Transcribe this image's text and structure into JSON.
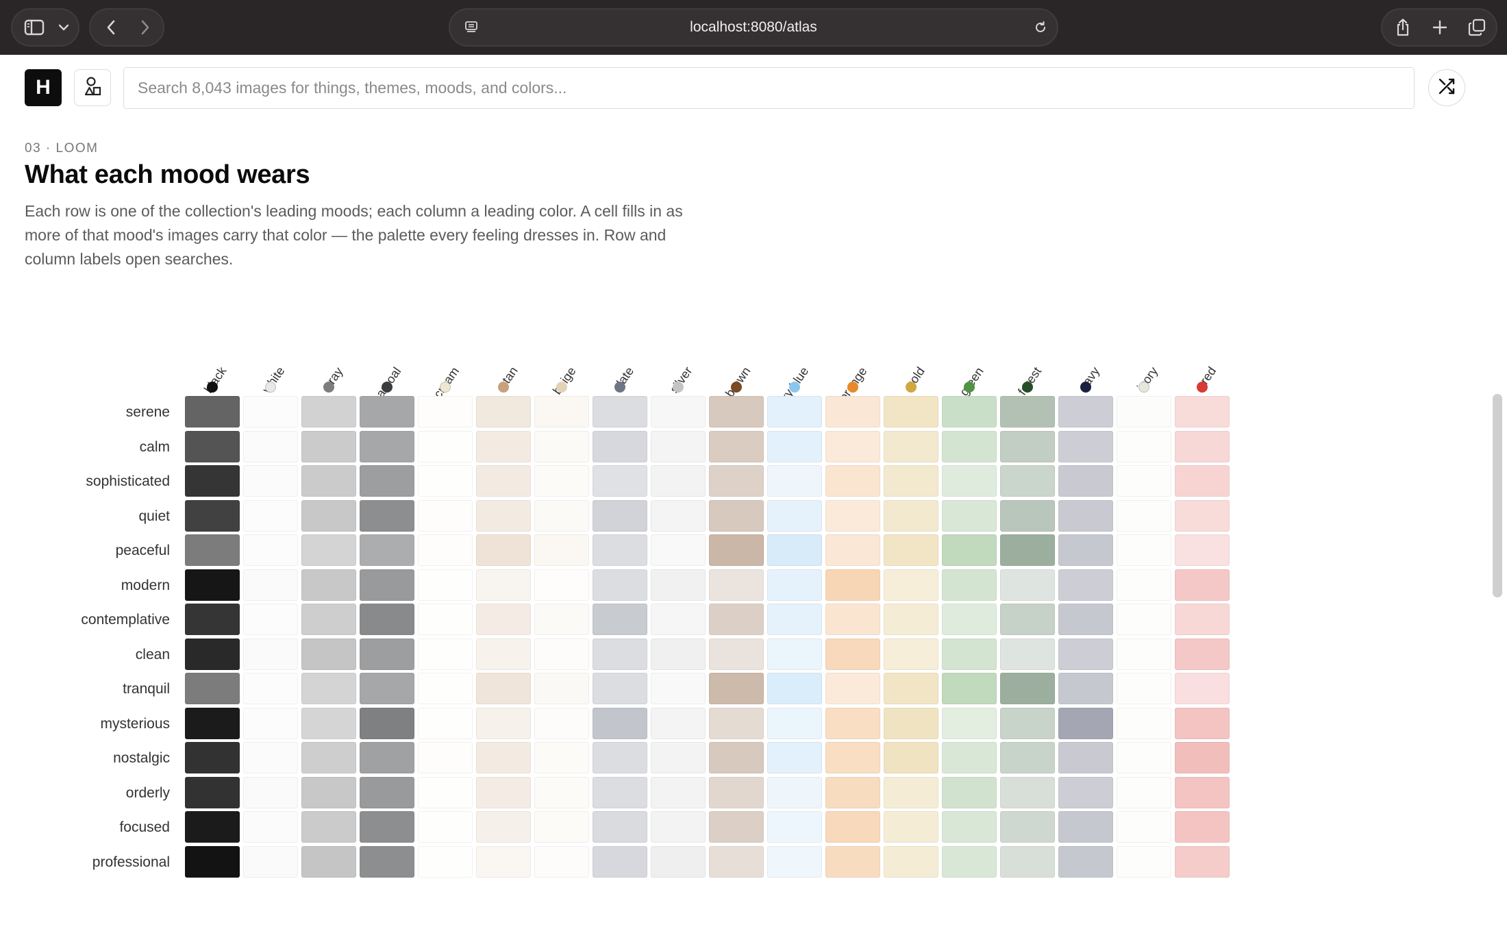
{
  "browser": {
    "url": "localhost:8080/atlas"
  },
  "header": {
    "logo_letter": "H",
    "search_placeholder": "Search 8,043 images for things, themes, moods, and colors..."
  },
  "intro": {
    "eyebrow": "03 · LOOM",
    "title": "What each mood wears",
    "description": "Each row is one of the collection's leading moods; each column a leading color. A cell fills in as more of that mood's images carry that color — the palette every feeling dresses in. Row and column labels open searches."
  },
  "heatmap": {
    "columns": [
      {
        "label": "black",
        "color": "#111111"
      },
      {
        "label": "white",
        "color": "#e8e8e8"
      },
      {
        "label": "gray",
        "color": "#7d7d7d"
      },
      {
        "label": "charcoal",
        "color": "#3a3c3f"
      },
      {
        "label": "cream",
        "color": "#efe8cf"
      },
      {
        "label": "tan",
        "color": "#c8a27a"
      },
      {
        "label": "beige",
        "color": "#e3d2b4"
      },
      {
        "label": "slate",
        "color": "#6e7584"
      },
      {
        "label": "silver",
        "color": "#c4c4c6"
      },
      {
        "label": "brown",
        "color": "#7a4a22"
      },
      {
        "label": "sky blue",
        "color": "#8cc6ee"
      },
      {
        "label": "orange",
        "color": "#e8892c"
      },
      {
        "label": "gold",
        "color": "#d0a83e"
      },
      {
        "label": "green",
        "color": "#4f9343"
      },
      {
        "label": "forest",
        "color": "#244e2a"
      },
      {
        "label": "navy",
        "color": "#1c2141"
      },
      {
        "label": "ivory",
        "color": "#e7e6dc"
      },
      {
        "label": "red",
        "color": "#d93a34"
      }
    ],
    "rows": [
      {
        "label": "serene",
        "values": [
          0.65,
          0.08,
          0.35,
          0.45,
          0.08,
          0.25,
          0.15,
          0.25,
          0.07,
          0.3,
          0.25,
          0.2,
          0.3,
          0.3,
          0.35,
          0.22,
          0.05,
          0.18
        ]
      },
      {
        "label": "calm",
        "values": [
          0.72,
          0.09,
          0.4,
          0.45,
          0.06,
          0.22,
          0.12,
          0.28,
          0.1,
          0.28,
          0.25,
          0.18,
          0.25,
          0.25,
          0.28,
          0.22,
          0.04,
          0.2
        ]
      },
      {
        "label": "sophisticated",
        "values": [
          0.85,
          0.09,
          0.4,
          0.5,
          0.06,
          0.22,
          0.1,
          0.22,
          0.12,
          0.25,
          0.15,
          0.22,
          0.25,
          0.18,
          0.24,
          0.24,
          0.04,
          0.22
        ]
      },
      {
        "label": "quiet",
        "values": [
          0.8,
          0.08,
          0.42,
          0.58,
          0.08,
          0.22,
          0.12,
          0.32,
          0.1,
          0.3,
          0.22,
          0.18,
          0.25,
          0.22,
          0.32,
          0.24,
          0.04,
          0.18
        ]
      },
      {
        "label": "peaceful",
        "values": [
          0.55,
          0.07,
          0.33,
          0.42,
          0.08,
          0.3,
          0.15,
          0.25,
          0.04,
          0.4,
          0.35,
          0.2,
          0.3,
          0.35,
          0.45,
          0.25,
          0.04,
          0.15
        ]
      },
      {
        "label": "modern",
        "values": [
          0.98,
          0.12,
          0.42,
          0.52,
          0.04,
          0.12,
          0.05,
          0.25,
          0.14,
          0.15,
          0.22,
          0.35,
          0.2,
          0.25,
          0.15,
          0.22,
          0.03,
          0.28
        ]
      },
      {
        "label": "contemplative",
        "values": [
          0.85,
          0.08,
          0.38,
          0.6,
          0.06,
          0.2,
          0.12,
          0.38,
          0.08,
          0.26,
          0.22,
          0.22,
          0.22,
          0.18,
          0.26,
          0.25,
          0.04,
          0.2
        ]
      },
      {
        "label": "clean",
        "values": [
          0.9,
          0.14,
          0.45,
          0.5,
          0.05,
          0.14,
          0.07,
          0.25,
          0.15,
          0.16,
          0.18,
          0.32,
          0.2,
          0.25,
          0.15,
          0.22,
          0.03,
          0.28
        ]
      },
      {
        "label": "tranquil",
        "values": [
          0.55,
          0.07,
          0.33,
          0.45,
          0.06,
          0.28,
          0.14,
          0.25,
          0.05,
          0.38,
          0.32,
          0.18,
          0.3,
          0.35,
          0.45,
          0.25,
          0.04,
          0.16
        ]
      },
      {
        "label": "mysterious",
        "values": [
          0.96,
          0.08,
          0.32,
          0.65,
          0.05,
          0.15,
          0.07,
          0.42,
          0.1,
          0.2,
          0.18,
          0.28,
          0.32,
          0.16,
          0.25,
          0.4,
          0.03,
          0.3
        ]
      },
      {
        "label": "nostalgic",
        "values": [
          0.86,
          0.1,
          0.38,
          0.48,
          0.08,
          0.22,
          0.1,
          0.25,
          0.12,
          0.3,
          0.25,
          0.28,
          0.32,
          0.22,
          0.25,
          0.24,
          0.03,
          0.33
        ]
      },
      {
        "label": "orderly",
        "values": [
          0.86,
          0.12,
          0.42,
          0.52,
          0.05,
          0.2,
          0.1,
          0.25,
          0.12,
          0.22,
          0.15,
          0.3,
          0.22,
          0.26,
          0.18,
          0.22,
          0.03,
          0.3
        ]
      },
      {
        "label": "focused",
        "values": [
          0.96,
          0.11,
          0.4,
          0.58,
          0.05,
          0.16,
          0.09,
          0.26,
          0.12,
          0.26,
          0.16,
          0.32,
          0.22,
          0.22,
          0.22,
          0.25,
          0.03,
          0.3
        ]
      },
      {
        "label": "professional",
        "values": [
          0.99,
          0.12,
          0.45,
          0.58,
          0.05,
          0.1,
          0.06,
          0.28,
          0.16,
          0.18,
          0.14,
          0.3,
          0.22,
          0.22,
          0.18,
          0.25,
          0.03,
          0.26
        ]
      }
    ]
  }
}
